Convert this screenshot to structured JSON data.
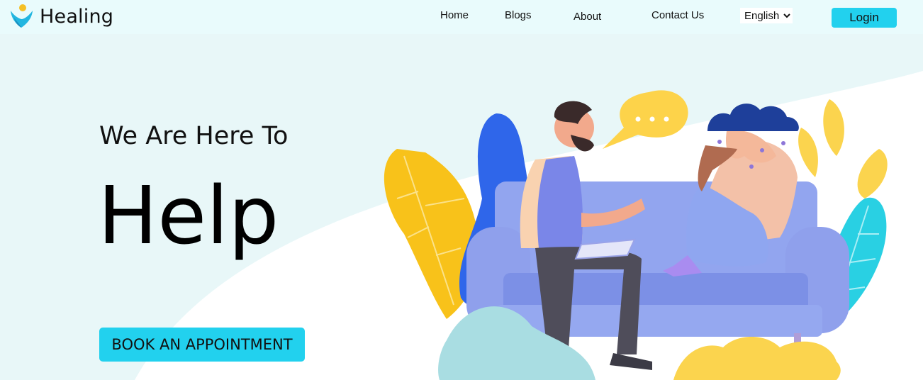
{
  "brand": {
    "name": "Healing",
    "logo_icon": "heart-person-logo-icon"
  },
  "nav": {
    "home": "Home",
    "blogs": "Blogs",
    "about": "About",
    "contact": "Contact Us",
    "language": {
      "selected": "English",
      "options": [
        "English"
      ]
    },
    "login": "Login"
  },
  "hero": {
    "subtitle": "We Are Here To",
    "title": "Help",
    "cta": "BOOK AN APPOINTMENT"
  },
  "colors": {
    "accent": "#22d1ee",
    "navbar_bg": "#e9fbfc",
    "page_bg": "#e8f7f8",
    "sofa": "#8fa3ec",
    "cloud": "#1e3f9a",
    "speech_bubble": "#fdd34a"
  },
  "illustration": {
    "icon": "therapy-session-illustration"
  }
}
